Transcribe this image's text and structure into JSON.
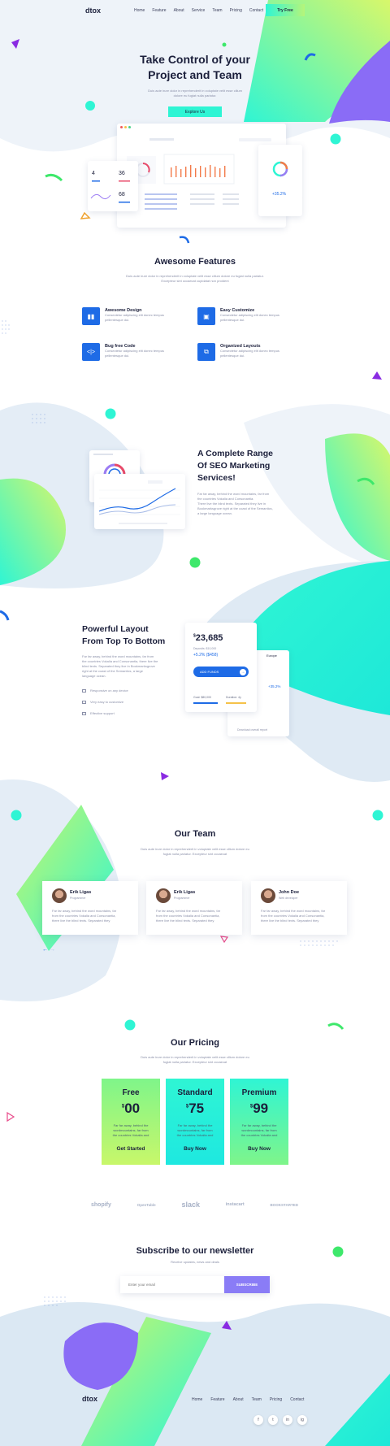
{
  "brand": {
    "logo": "dtox"
  },
  "nav": {
    "items": [
      "Home",
      "Feature",
      "About",
      "Service",
      "Team",
      "Pricing",
      "Contact"
    ],
    "cta": "Try Free"
  },
  "hero": {
    "title_line1": "Take Control of your",
    "title_line2": "Project and Team",
    "subtitle_line1": "Duis aute irure dolor in reprehenderit in voluptate velit esse cillum",
    "subtitle_line2": "dolore eu fugiat nulla pariatur.",
    "button": "Explore Us"
  },
  "dashboard": {
    "stat1": "4",
    "stat2": "36",
    "stat3": "68",
    "stat4": "+35.2%"
  },
  "features": {
    "title": "Awesome Features",
    "subtitle_line1": "Duis aute irure dolor in reprehenderit in voluptate velit esse cillum dolore eu fugiat nulla pariatur.",
    "subtitle_line2": "Excepteur sint occaecat cupidatat non proident",
    "items": [
      {
        "title": "Awesome Design",
        "desc1": "Consectetur adipiscing elit donec tempus",
        "desc2": "pellentesque dui."
      },
      {
        "title": "Easy Customize",
        "desc1": "Consectetur adipiscing elit donec tempus",
        "desc2": "pellentesque dui."
      },
      {
        "title": "Bug free Code",
        "desc1": "Consectetur adipiscing elit donec tempus",
        "desc2": "pellentesque dui."
      },
      {
        "title": "Organized Layouts",
        "desc1": "Consectetur adipiscing elit donec tempus",
        "desc2": "pellentesque dui."
      }
    ]
  },
  "seo": {
    "title_line1": "A Complete Range",
    "title_line2": "Of SEO Marketing",
    "title_line3": "Services!",
    "desc1": "Far far away, behind the word mountains, far from",
    "desc2": "the countries Vokalia and Consonantia.",
    "desc3": "There live the blind texts. Separated they live in",
    "desc4": "Bookmarksgrove right at the coast of the Semantics,",
    "desc5": "a large language ocean."
  },
  "layout": {
    "title_line1": "Powerful Layout",
    "title_line2": "From Top To Bottom",
    "desc1": "Far far away, behind the word mountains, far from",
    "desc2": "the countries Vokalia and Consonantia, there live the",
    "desc3": "blind texts. Separated they live in Bookmarksgrove",
    "desc4": "right at the coast of the Semantics, a large",
    "desc5": "language ocean.",
    "checks": [
      "Responsive on any device",
      "Very easy to customize",
      "Effective support"
    ],
    "widget": {
      "amount": "23,685",
      "currency": "$",
      "sub": "Deposits: $10,000",
      "change": "+5.2% ($458)",
      "button": "ADD FUNDS",
      "goal_label": "Goal: $80,000",
      "duration_label": "Duration: 4y",
      "region": "Europe",
      "region_change": "+35.2%",
      "footer": "Download overall report"
    }
  },
  "team": {
    "title": "Our Team",
    "subtitle_line1": "Duis aute irure dolor in reprehenderit in voluptate velit esse cillum dolore eu",
    "subtitle_line2": "fugiat nulla pariatur. Excepteur sint occaecat",
    "members": [
      {
        "name": "Erik Ligas",
        "role": "Programmer",
        "d1": "Far far away, behind the word mountains, far",
        "d2": "from the countries Vokalia and Consonantia,",
        "d3": "there live the blind texts. Separated they"
      },
      {
        "name": "Erik Ligas",
        "role": "Programmer",
        "d1": "Far far away, behind the word mountains, far",
        "d2": "from the countries Vokalia and Consonantia,",
        "d3": "there live the blind texts. Separated they"
      },
      {
        "name": "John Doe",
        "role": "Web developer",
        "d1": "Far far away, behind the word mountains, far",
        "d2": "from the countries Vokalia and Consonantia,",
        "d3": "there live the blind texts. Separated they"
      }
    ]
  },
  "pricing": {
    "title": "Our Pricing",
    "subtitle_line1": "Duis aute irure dolor in reprehenderit in voluptate velit esse cillum dolore eu",
    "subtitle_line2": "fugiat nulla pariatur. Excepteur sint occaecat",
    "plans": [
      {
        "name": "Free",
        "price": "00",
        "currency": "$",
        "d1": "Far far away, behind the",
        "d2": "wordmountains, far from",
        "d3": "the countries Vokalia and",
        "button": "Get Started"
      },
      {
        "name": "Standard",
        "price": "75",
        "currency": "$",
        "d1": "Far far away, behind the",
        "d2": "wordmountains, far from",
        "d3": "the countries Vokalia and",
        "button": "Buy Now"
      },
      {
        "name": "Premium",
        "price": "99",
        "currency": "$",
        "d1": "Far far away, behind the",
        "d2": "wordmountains, far from",
        "d3": "the countries Vokalia and",
        "button": "Buy Now"
      }
    ]
  },
  "logos": [
    "shopify",
    "OpenTable",
    "slack",
    "instacart",
    "BOOKSTARTED"
  ],
  "newsletter": {
    "title": "Subscribe to our newsletter",
    "subtitle": "Receive updates, news and deals",
    "placeholder": "Enter your email",
    "button": "SUBSCRIBE"
  },
  "footer": {
    "logo": "dtox",
    "links": [
      "Home",
      "Feature",
      "About",
      "Team",
      "Pricing",
      "Contact"
    ],
    "socials": [
      "f",
      "t",
      "in",
      "ig"
    ]
  },
  "colors": {
    "accent_blue": "#1e6be6",
    "mint": "#2ff5d4",
    "lime": "#b6f57a",
    "purple": "#8a5cf6",
    "dark": "#1b1f3b"
  }
}
